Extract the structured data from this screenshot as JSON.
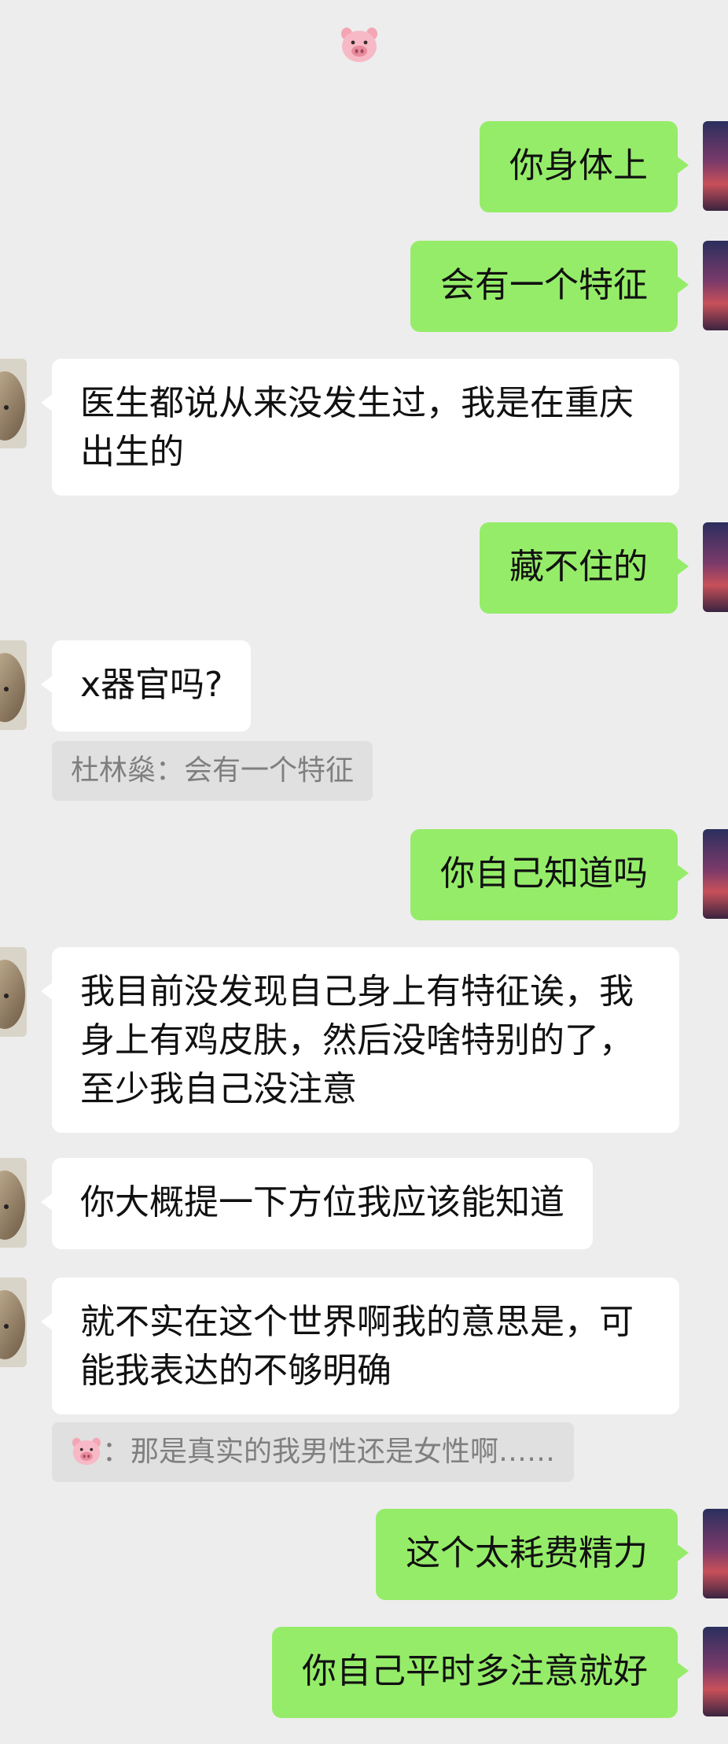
{
  "header": {
    "title_icon": "pig-emoji"
  },
  "messages": [
    {
      "side": "sent",
      "text": "你身体上"
    },
    {
      "side": "sent",
      "text": "会有一个特征"
    },
    {
      "side": "recv",
      "text": "医生都说从来没发生过，我是在重庆出生的"
    },
    {
      "side": "sent",
      "text": "藏不住的"
    },
    {
      "side": "recv",
      "text": "x器官吗?"
    },
    {
      "side": "sent",
      "text": "你自己知道吗"
    },
    {
      "side": "recv",
      "text": "我目前没发现自己身上有特征诶，我身上有鸡皮肤，然后没啥特别的了，至少我自己没注意"
    },
    {
      "side": "recv",
      "text": "你大概提一下方位我应该能知道"
    },
    {
      "side": "recv",
      "text": "就不实在这个世界啊我的意思是，可能我表达的不够明确"
    },
    {
      "side": "sent",
      "text": "这个太耗费精力"
    },
    {
      "side": "sent",
      "text": "你自己平时多注意就好"
    }
  ],
  "quotes": [
    {
      "author": "杜林燊",
      "separator": "：",
      "text": "会有一个特征"
    },
    {
      "author_icon": "pig-emoji",
      "separator": "：",
      "text": "那是真实的我男性还是女性啊……"
    }
  ],
  "colors": {
    "background": "#ededed",
    "sent_bubble": "#95ec69",
    "recv_bubble": "#ffffff",
    "quote_bg": "#e0e0e0",
    "quote_text": "#7f7f7f"
  }
}
